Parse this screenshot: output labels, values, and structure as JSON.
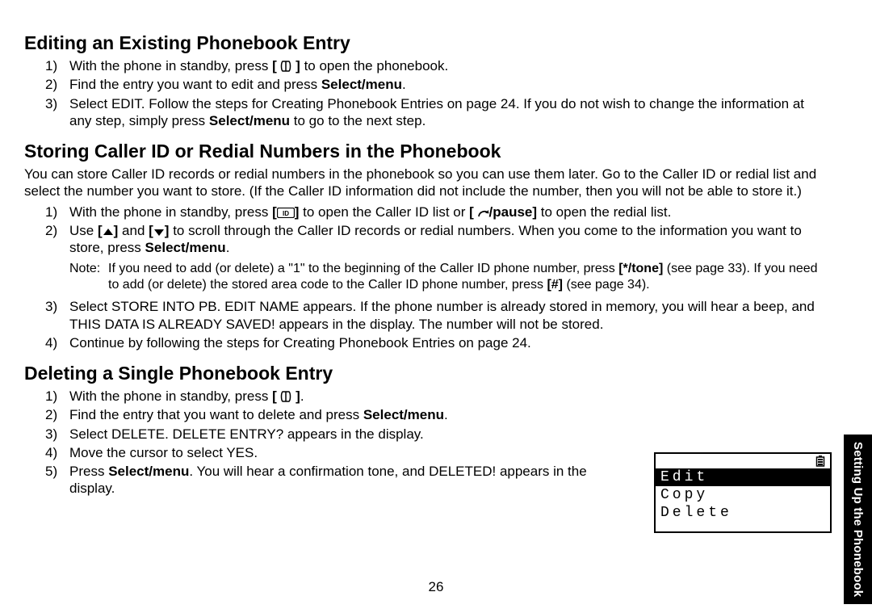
{
  "section1": {
    "title": "Editing an Existing Phonebook Entry",
    "step1_a": "With the phone in standby, press ",
    "step1_b": " to open the phonebook.",
    "step2_a": "Find the entry you want to edit and press ",
    "step2_b": "Select/menu",
    "step2_c": ".",
    "step3_a": "Select EDIT. Follow the steps for Creating Phonebook Entries on page 24. If you do not wish to change the information at any step, simply press ",
    "step3_b": "Select/menu",
    "step3_c": " to go to the next step."
  },
  "section2": {
    "title": "Storing Caller ID or Redial Numbers in the Phonebook",
    "intro": "You can store Caller ID records or redial numbers in the phonebook so you can use them later. Go to the Caller ID or redial list and select the number you want to store. (If the Caller ID information did not include the number, then you will not be able to store it.)",
    "step1_a": "With the phone in standby, press ",
    "step1_b": " to open the Caller ID list or ",
    "step1_c": "/pause]",
    "step1_d": " to open the redial list.",
    "step2_a": "Use ",
    "step2_b": " and ",
    "step2_c": " to scroll through the Caller ID records or redial numbers. When you come to the information you want to store, press ",
    "step2_d": "Select/menu",
    "step2_e": ".",
    "note_label": "Note:",
    "note_a": "If you need to add (or delete) a \"1\" to the beginning of the Caller ID phone number, press ",
    "note_b": "[*/tone]",
    "note_c": " (see page 33). If you need to add (or delete) the stored area code to the Caller ID phone number, press ",
    "note_d": "[#]",
    "note_e": " (see page 34).",
    "step3": "Select STORE INTO PB. EDIT NAME appears. If the phone number is already stored in memory, you will hear a beep, and THIS DATA IS ALREADY SAVED! appears in the display. The number will not be stored.",
    "step4": "Continue by following the steps for Creating Phonebook Entries on page 24."
  },
  "section3": {
    "title": "Deleting a Single Phonebook Entry",
    "step1_a": "With the phone in standby, press ",
    "step1_b": ".",
    "step2_a": "Find the entry that you want to delete and press ",
    "step2_b": "Select/menu",
    "step2_c": ".",
    "step3": "Select DELETE. DELETE ENTRY? appears in the display.",
    "step4": "Move the cursor to select YES.",
    "step5_a": "Press ",
    "step5_b": "Select/menu",
    "step5_c": ". You will hear a confirmation tone, and DELETED! appears in the display."
  },
  "lcd": {
    "row1": "Edit",
    "row2": "Copy",
    "row3": "Delete"
  },
  "side_tab": "Setting Up the Phonebook",
  "page_number": "26",
  "icons": {
    "phonebook": "[ 📖 ]",
    "cid": "[⬜ᴵᴰ]",
    "redial": "[ ↺",
    "up": "[▲]",
    "down": "[▼]"
  }
}
